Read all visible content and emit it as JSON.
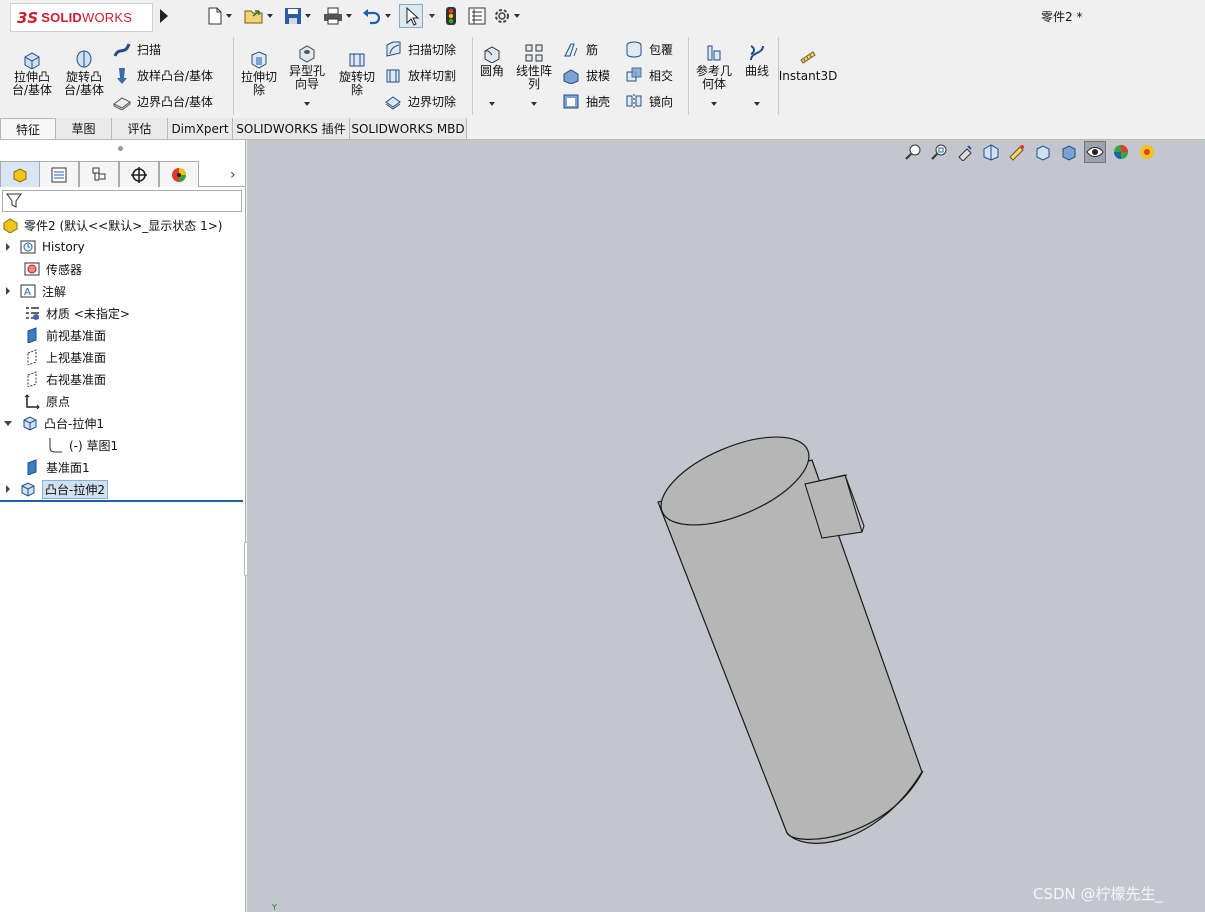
{
  "app": {
    "logo_ds": "3S",
    "logo_solid": "SOLID",
    "logo_works": "WORKS",
    "doc_title": "零件2 *"
  },
  "quick_access": [
    {
      "icon": "new-document-icon"
    },
    {
      "icon": "open-folder-icon"
    },
    {
      "icon": "save-icon"
    },
    {
      "icon": "print-icon"
    },
    {
      "icon": "undo-icon"
    },
    {
      "icon": "select-arrow-icon"
    },
    {
      "icon": "rebuild-traffic-light-icon"
    },
    {
      "icon": "file-properties-icon"
    },
    {
      "icon": "options-gear-icon"
    }
  ],
  "ribbon": {
    "extrude_boss": "拉伸凸台/基体",
    "revolve_boss": "旋转凸台/基体",
    "sweep": "扫描",
    "loft_boss": "放样凸台/基体",
    "boundary_boss": "边界凸台/基体",
    "extrude_cut": "拉伸切除",
    "hole_wizard": "异型孔向导",
    "revolve_cut": "旋转切除",
    "sweep_cut": "扫描切除",
    "loft_cut": "放样切割",
    "boundary_cut": "边界切除",
    "fillet": "圆角",
    "linear_pattern": "线性阵列",
    "rib": "筋",
    "draft": "拔模",
    "shell": "抽壳",
    "wrap": "包覆",
    "intersect": "相交",
    "mirror": "镜向",
    "ref_geometry": "参考几何体",
    "curves": "曲线",
    "instant3d": "Instant3D"
  },
  "tabs": [
    "特征",
    "草图",
    "评估",
    "DimXpert",
    "SOLIDWORKS 插件",
    "SOLIDWORKS MBD"
  ],
  "panel": {
    "more": "›"
  },
  "tree": {
    "root": "零件2  (默认<<默认>_显示状态 1>)",
    "history": "History",
    "sensors": "传感器",
    "annotations": "注解",
    "material": "材质 <未指定>",
    "front_plane": "前视基准面",
    "top_plane": "上视基准面",
    "right_plane": "右视基准面",
    "origin": "原点",
    "boss_extrude1": "凸台-拉伸1",
    "sketch1": "(-) 草图1",
    "plane1": "基准面1",
    "boss_extrude2": "凸台-拉伸2"
  },
  "viewport": {
    "triad_axis": "Y",
    "watermark": "CSDN @柠檬先生_",
    "background": "#c3c6ce",
    "body_color": "#b6b6b6"
  }
}
